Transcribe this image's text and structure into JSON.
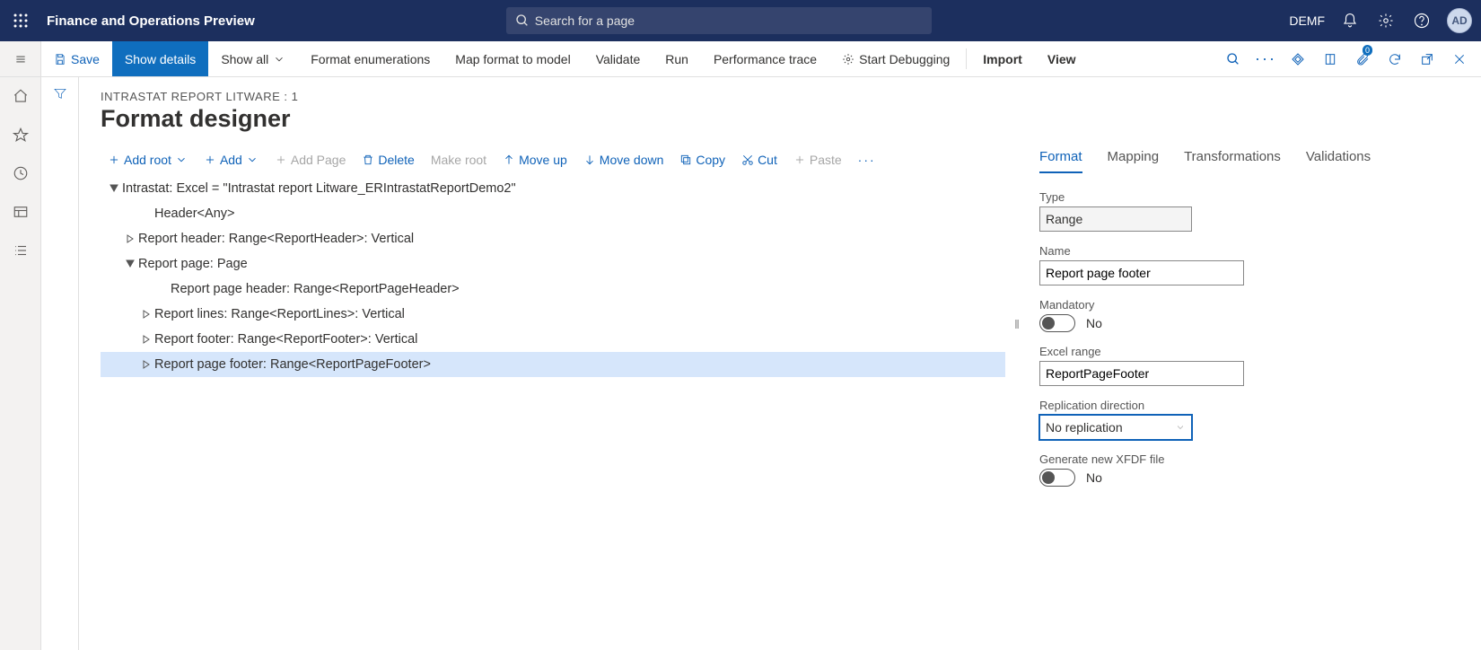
{
  "banner": {
    "app_title": "Finance and Operations Preview",
    "search_placeholder": "Search for a page",
    "company": "DEMF",
    "avatar": "AD"
  },
  "cmd": {
    "save": "Save",
    "show_details": "Show details",
    "show_all": "Show all",
    "format_enum": "Format enumerations",
    "map_model": "Map format to model",
    "validate": "Validate",
    "run": "Run",
    "perf_trace": "Performance trace",
    "start_debug": "Start Debugging",
    "import": "Import",
    "view": "View",
    "badge_count": "0"
  },
  "page": {
    "crumb": "INTRASTAT REPORT LITWARE : 1",
    "title": "Format designer"
  },
  "tree_tb": {
    "add_root": "Add root",
    "add": "Add",
    "add_page": "Add Page",
    "delete": "Delete",
    "make_root": "Make root",
    "move_up": "Move up",
    "move_down": "Move down",
    "copy": "Copy",
    "cut": "Cut",
    "paste": "Paste"
  },
  "tree": {
    "n0": "Intrastat: Excel = \"Intrastat report Litware_ERIntrastatReportDemo2\"",
    "n1": "Header<Any>",
    "n2": "Report header: Range<ReportHeader>: Vertical",
    "n3": "Report page: Page",
    "n4": "Report page header: Range<ReportPageHeader>",
    "n5": "Report lines: Range<ReportLines>: Vertical",
    "n6": "Report footer: Range<ReportFooter>: Vertical",
    "n7": "Report page footer: Range<ReportPageFooter>"
  },
  "panel": {
    "tabs": {
      "format": "Format",
      "mapping": "Mapping",
      "transformations": "Transformations",
      "validations": "Validations"
    },
    "type_label": "Type",
    "type_value": "Range",
    "name_label": "Name",
    "name_value": "Report page footer",
    "mandatory_label": "Mandatory",
    "mandatory_value": "No",
    "excel_label": "Excel range",
    "excel_value": "ReportPageFooter",
    "repl_label": "Replication direction",
    "repl_value": "No replication",
    "xfdf_label": "Generate new XFDF file",
    "xfdf_value": "No"
  }
}
